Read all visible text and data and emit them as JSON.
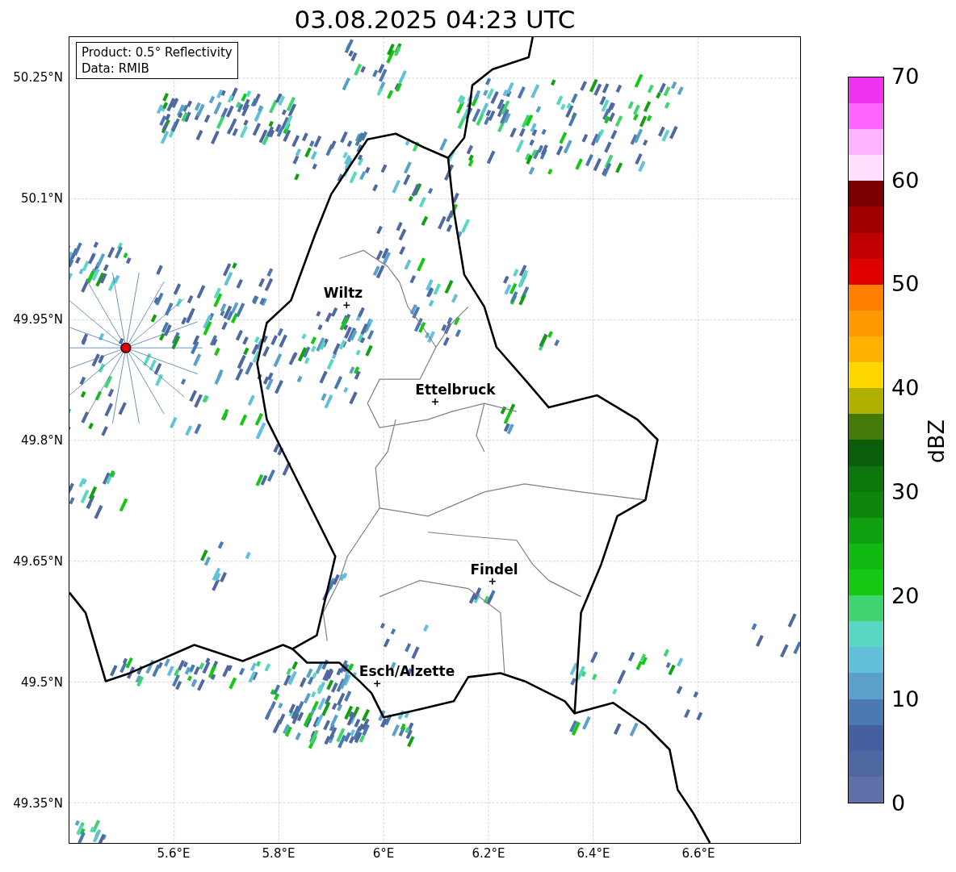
{
  "title": "03.08.2025 04:23 UTC",
  "map": {
    "info": [
      "Product: 0.5° Reflectivity",
      "Data: RMIB"
    ],
    "lat_ticks": [
      "50.25°N",
      "50.1°N",
      "49.95°N",
      "49.8°N",
      "49.65°N",
      "49.5°N",
      "49.35°N"
    ],
    "lon_ticks": [
      "5.6°E",
      "5.8°E",
      "6°E",
      "6.2°E",
      "6.4°E",
      "6.6°E"
    ],
    "cities": [
      {
        "name": "Wiltz"
      },
      {
        "name": "Ettelbruck"
      },
      {
        "name": "Findel"
      },
      {
        "name": "Esch/Alzette"
      }
    ]
  },
  "colorbar": {
    "label": "dBZ",
    "ticks": [
      "70",
      "60",
      "50",
      "40",
      "30",
      "20",
      "10",
      "0"
    ],
    "bins": [
      {
        "color": "#6070a8"
      },
      {
        "color": "#5068a0"
      },
      {
        "color": "#4460a0"
      },
      {
        "color": "#4a78b0"
      },
      {
        "color": "#5aa0c8"
      },
      {
        "color": "#62c0dc"
      },
      {
        "color": "#5cd6c4"
      },
      {
        "color": "#3fd46f"
      },
      {
        "color": "#14c814"
      },
      {
        "color": "#12b812"
      },
      {
        "color": "#10a010"
      },
      {
        "color": "#0e860e"
      },
      {
        "color": "#0d760d"
      },
      {
        "color": "#0b5c0b"
      },
      {
        "color": "#437a0a"
      },
      {
        "color": "#b0b000"
      },
      {
        "color": "#ffd700"
      },
      {
        "color": "#ffb300"
      },
      {
        "color": "#ff9900"
      },
      {
        "color": "#ff7f00"
      },
      {
        "color": "#e00000"
      },
      {
        "color": "#c00000"
      },
      {
        "color": "#a00000"
      },
      {
        "color": "#7a0000"
      },
      {
        "color": "#ffe0ff"
      },
      {
        "color": "#ffb3ff"
      },
      {
        "color": "#ff66ff"
      },
      {
        "color": "#ee33ee"
      }
    ]
  }
}
